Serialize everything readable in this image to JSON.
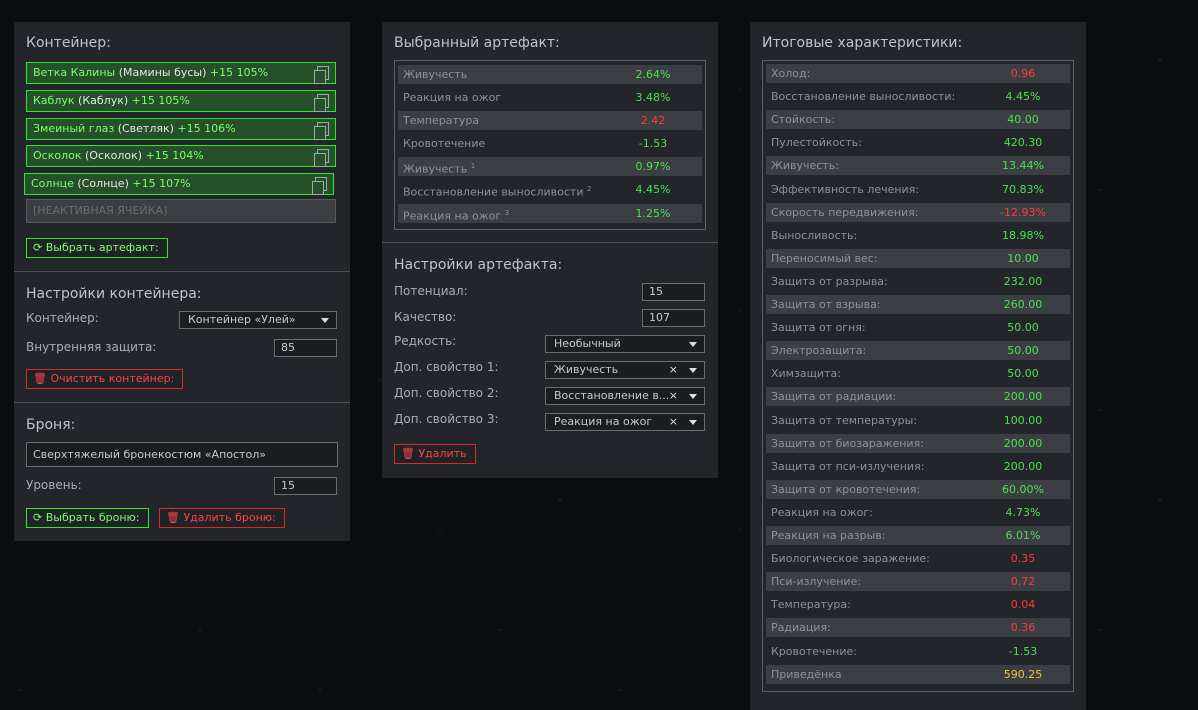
{
  "container_panel": {
    "title": "Контейнер:",
    "slots": [
      {
        "name": "Ветка Калины",
        "sub": "(Мамины бусы)",
        "bonus": "+15 105%"
      },
      {
        "name": "Каблук",
        "sub": "(Каблук)",
        "bonus": "+15 105%"
      },
      {
        "name": "Змеиный глаз",
        "sub": "(Светляк)",
        "bonus": "+15 106%"
      },
      {
        "name": "Осколок",
        "sub": "(Осколок)",
        "bonus": "+15 104%"
      },
      {
        "name": "Солнце",
        "sub": "(Солнце)",
        "bonus": "+15 107%"
      }
    ],
    "inactive_slot": "[НЕАКТИВНАЯ ЯЧЕЙКА]",
    "choose_artifact_label": "Выбрать артефакт:",
    "settings_title": "Настройки контейнера:",
    "container_label": "Контейнер:",
    "container_value": "Контейнер «Улей»",
    "inner_protection_label": "Внутренняя защита:",
    "inner_protection_value": "85",
    "clear_label": "Очистить контейнер:"
  },
  "armor_panel": {
    "title": "Броня:",
    "armor_value": "Сверхтяжелый бронекостюм «Апостол»",
    "level_label": "Уровень:",
    "level_value": "15",
    "choose_label": "Выбрать броню:",
    "delete_label": "Удалить броню:"
  },
  "artifact_panel": {
    "title": "Выбранный артефакт:",
    "stats": [
      {
        "name": "Живучесть",
        "sup": "",
        "value": "2.64%",
        "kind": "pos"
      },
      {
        "name": "Реакция на ожог",
        "sup": "",
        "value": "3.48%",
        "kind": "pos"
      },
      {
        "name": "Температура",
        "sup": "",
        "value": "2.42",
        "kind": "neg"
      },
      {
        "name": "Кровотечение",
        "sup": "",
        "value": "-1.53",
        "kind": "pos"
      },
      {
        "name": "Живучесть",
        "sup": "1",
        "value": "0.97%",
        "kind": "pos"
      },
      {
        "name": "Восстановление выносливости",
        "sup": "2",
        "value": "4.45%",
        "kind": "pos"
      },
      {
        "name": "Реакция на ожог",
        "sup": "3",
        "value": "1.25%",
        "kind": "pos"
      }
    ],
    "settings_title": "Настройки артефакта:",
    "potential_label": "Потенциал:",
    "potential_value": "15",
    "quality_label": "Качество:",
    "quality_value": "107",
    "rarity_label": "Редкость:",
    "rarity_value": "Необычный",
    "extra1_label": "Доп. свойство 1:",
    "extra1_value": "Живучесть",
    "extra2_label": "Доп. свойство 2:",
    "extra2_value": "Восстановление в...",
    "extra3_label": "Доп. свойство 3:",
    "extra3_value": "Реакция на ожог",
    "clear_mark": "×",
    "delete_label": "Удалить"
  },
  "totals_panel": {
    "title": "Итоговые характеристики:",
    "stats": [
      {
        "name": "Холод:",
        "value": "0.96",
        "kind": "neg"
      },
      {
        "name": "Восстановление выносливости:",
        "value": "4.45%",
        "kind": "pos"
      },
      {
        "name": "Стойкость:",
        "value": "40.00",
        "kind": "pos"
      },
      {
        "name": "Пулестойкость:",
        "value": "420.30",
        "kind": "pos"
      },
      {
        "name": "Живучесть:",
        "value": "13.44%",
        "kind": "pos"
      },
      {
        "name": "Эффективность лечения:",
        "value": "70.83%",
        "kind": "pos"
      },
      {
        "name": "Скорость передвижения:",
        "value": "-12.93%",
        "kind": "neg"
      },
      {
        "name": "Выносливость:",
        "value": "18.98%",
        "kind": "pos"
      },
      {
        "name": "Переносимый вес:",
        "value": "10.00",
        "kind": "pos"
      },
      {
        "name": "Защита от разрыва:",
        "value": "232.00",
        "kind": "pos"
      },
      {
        "name": "Защита от взрыва:",
        "value": "260.00",
        "kind": "pos"
      },
      {
        "name": "Защита от огня:",
        "value": "50.00",
        "kind": "pos"
      },
      {
        "name": "Электрозащита:",
        "value": "50.00",
        "kind": "pos"
      },
      {
        "name": "Химзащита:",
        "value": "50.00",
        "kind": "pos"
      },
      {
        "name": "Защита от радиации:",
        "value": "200.00",
        "kind": "pos"
      },
      {
        "name": "Защита от температуры:",
        "value": "100.00",
        "kind": "pos"
      },
      {
        "name": "Защита от биозаражения:",
        "value": "200.00",
        "kind": "pos"
      },
      {
        "name": "Защита от пси-излучения:",
        "value": "200.00",
        "kind": "pos"
      },
      {
        "name": "Защита от кровотечения:",
        "value": "60.00%",
        "kind": "pos"
      },
      {
        "name": "Реакция на ожог:",
        "value": "4.73%",
        "kind": "pos"
      },
      {
        "name": "Реакция на разрыв:",
        "value": "6.01%",
        "kind": "pos"
      },
      {
        "name": "Биологическое заражение:",
        "value": "0.35",
        "kind": "neg"
      },
      {
        "name": "Пси-излучение:",
        "value": "0.72",
        "kind": "neg"
      },
      {
        "name": "Температура:",
        "value": "0.04",
        "kind": "neg"
      },
      {
        "name": "Радиация:",
        "value": "0.36",
        "kind": "neg"
      },
      {
        "name": "Кровотечение:",
        "value": "-1.53",
        "kind": "pos"
      },
      {
        "name": "Приведёнка",
        "value": "590.25",
        "kind": "gold"
      }
    ]
  }
}
